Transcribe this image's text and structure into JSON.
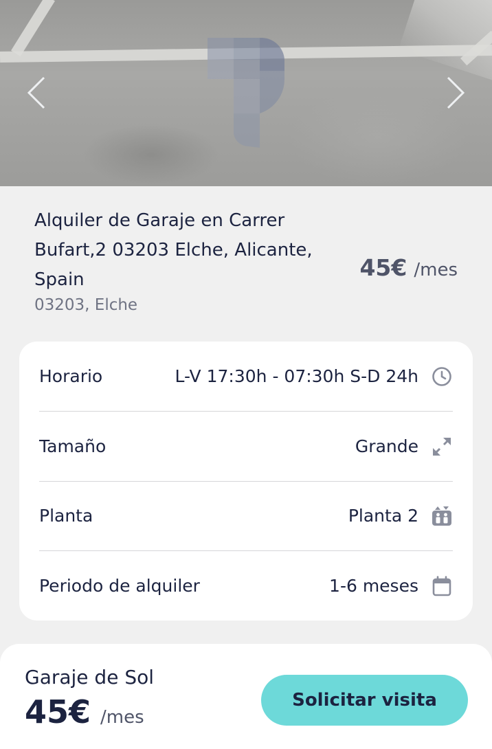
{
  "listing": {
    "title": "Alquiler de Garaje en Carrer Bufart,2 03203 Elche, Alicante, Spain",
    "location": "03203, Elche",
    "price": "45€",
    "price_unit": "/mes"
  },
  "gallery": {
    "prev_icon": "chevron-left-icon",
    "next_icon": "chevron-right-icon",
    "watermark": "parking-logo"
  },
  "details": [
    {
      "label": "Horario",
      "value": "L-V 17:30h - 07:30h S-D 24h",
      "icon": "clock-icon"
    },
    {
      "label": "Tamaño",
      "value": "Grande",
      "icon": "expand-arrows-icon"
    },
    {
      "label": "Planta",
      "value": "Planta 2",
      "icon": "elevator-icon"
    },
    {
      "label": "Periodo de alquiler",
      "value": "1-6 meses",
      "icon": "calendar-icon"
    }
  ],
  "footer": {
    "name": "Garaje de Sol",
    "price": "45€",
    "price_unit": "/mes",
    "cta_label": "Solicitar visita"
  },
  "colors": {
    "text_primary": "#1c2340",
    "text_secondary": "#6f7383",
    "icon_gray": "#8a8e9c",
    "accent": "#6dd9d9",
    "background": "#f0f0f0",
    "card": "#ffffff"
  }
}
